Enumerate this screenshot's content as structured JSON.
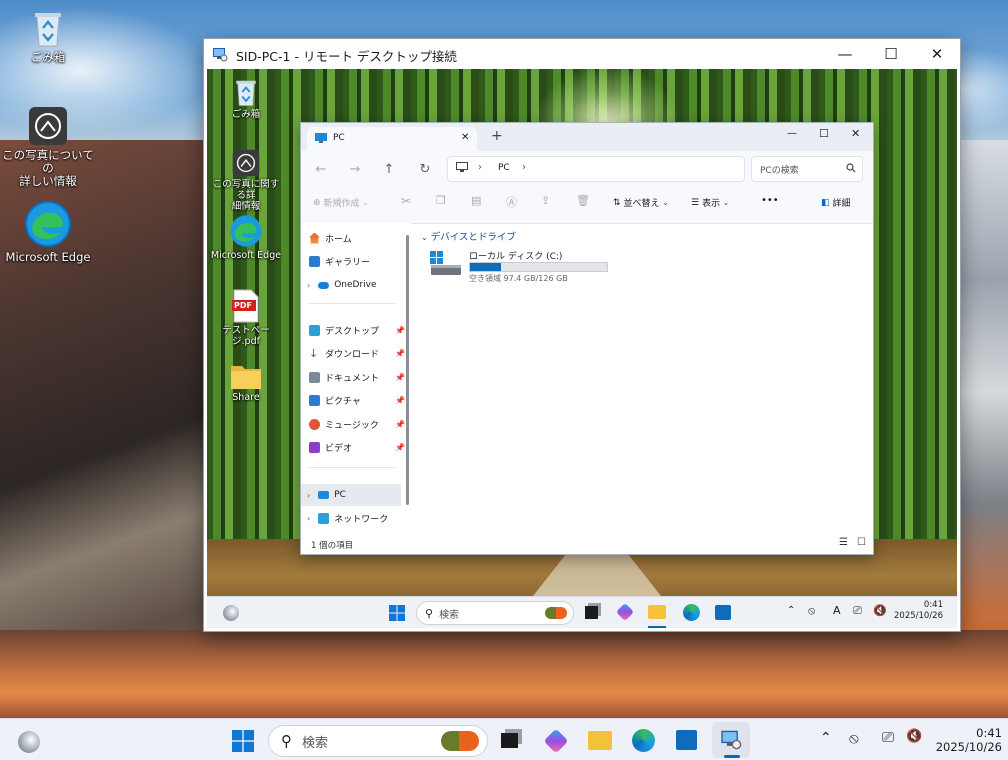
{
  "desktop": {
    "icons": [
      {
        "label": "ごみ箱",
        "icon": "recycle-bin-icon"
      },
      {
        "label": "この写真についての詳しい情報",
        "line1": "この写真についての",
        "line2": "詳しい情報",
        "icon": "camera-info-icon"
      },
      {
        "label": "Microsoft Edge",
        "icon": "edge-icon"
      }
    ]
  },
  "rdp_window": {
    "title": "SID-PC-1 - リモート デスクトップ接続",
    "minimize": "—",
    "maximize": "☐",
    "close": "✕"
  },
  "remote_desktop": {
    "icons": [
      {
        "label": "ごみ箱",
        "icon": "recycle-bin-icon"
      },
      {
        "label": "この写真に関する詳細情報",
        "line1": "この写真に関する詳",
        "line2": "細情報",
        "icon": "camera-info-icon"
      },
      {
        "label": "Microsoft Edge",
        "icon": "edge-icon"
      },
      {
        "label": "テストページ.pdf",
        "icon": "pdf-file-icon",
        "badge": "PDF"
      },
      {
        "label": "Share",
        "icon": "folder-icon"
      }
    ],
    "taskbar": {
      "search_placeholder": "検索",
      "clock_time": "0:41",
      "clock_date": "2025/10/26"
    }
  },
  "explorer": {
    "tab_title": "PC",
    "new_tab": "+",
    "close_tab": "✕",
    "minimize": "—",
    "maximize": "☐",
    "close": "✕",
    "address": {
      "sep1": "›",
      "location": "PC",
      "sep2": "›"
    },
    "search_placeholder": "PCの検索",
    "commands": {
      "new": "新規作成",
      "sort": "並べ替え",
      "view": "表示",
      "more": "•••",
      "details": "詳細"
    },
    "sidebar": {
      "items": [
        {
          "label": "ホーム",
          "pinned": false
        },
        {
          "label": "ギャラリー",
          "pinned": false
        },
        {
          "label": "OneDrive",
          "pinned": false
        },
        {
          "label": "デスクトップ",
          "pinned": true
        },
        {
          "label": "ダウンロード",
          "pinned": true
        },
        {
          "label": "ドキュメント",
          "pinned": true
        },
        {
          "label": "ピクチャ",
          "pinned": true
        },
        {
          "label": "ミュージック",
          "pinned": true
        },
        {
          "label": "ビデオ",
          "pinned": true
        },
        {
          "label": "PC",
          "pinned": false
        },
        {
          "label": "ネットワーク",
          "pinned": false
        }
      ]
    },
    "section_header": "デバイスとドライブ",
    "drive": {
      "name": "ローカル ディスク (C:)",
      "free_text": "空き領域 97.4 GB/126 GB",
      "used_fraction": 0.227
    },
    "status_text": "1 個の項目"
  },
  "taskbar": {
    "search_placeholder": "検索",
    "clock_time": "0:41",
    "clock_date": "2025/10/26"
  },
  "colors": {
    "accent": "#0067c0",
    "drive_bar": "#0f6cbd",
    "taskbar_bg": "#eef2f8"
  }
}
